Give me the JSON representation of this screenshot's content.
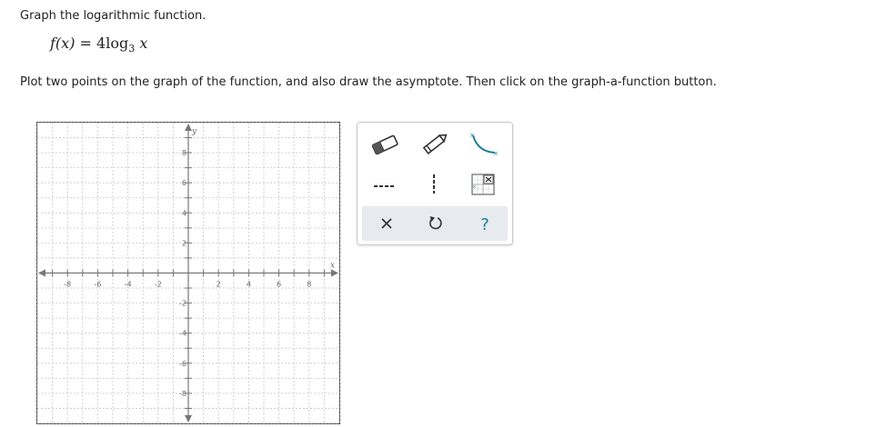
{
  "prompt": "Graph the logarithmic function.",
  "formula": {
    "lhs": "f(x)",
    "equals": "=",
    "coefficient": "4",
    "func": "log",
    "base": "3",
    "arg": "x"
  },
  "instructions": "Plot two points on the graph of the function, and also draw the asymptote. Then click on the graph-a-function button.",
  "graph": {
    "x_axis_label": "x",
    "y_axis_label": "y",
    "x_range": [
      -10,
      10
    ],
    "y_range": [
      -10,
      10
    ],
    "grid_step": 1,
    "x_tick_labels": [
      "-8",
      "-6",
      "-4",
      "-2",
      "2",
      "4",
      "6",
      "8"
    ],
    "y_tick_labels": [
      "8",
      "6",
      "4",
      "2",
      "-2",
      "-4",
      "-6",
      "-8"
    ],
    "grid": true
  },
  "tools": [
    {
      "name": "eraser-tool",
      "icon": "eraser-icon"
    },
    {
      "name": "pencil-tool",
      "icon": "pencil-icon"
    },
    {
      "name": "curve-tool",
      "icon": "curve-icon"
    },
    {
      "name": "horizontal-asymptote-tool",
      "icon": "dashed-horizontal-line-icon"
    },
    {
      "name": "vertical-asymptote-tool",
      "icon": "dashed-vertical-line-icon"
    },
    {
      "name": "graph-function-tool",
      "icon": "graph-function-icon"
    }
  ],
  "actions": {
    "clear": {
      "icon": "close-icon"
    },
    "undo": {
      "icon": "undo-icon"
    },
    "help": {
      "icon": "question-icon",
      "label": "?"
    }
  },
  "colors": {
    "accent": "#1a7f93",
    "grid": "#c8c8c8",
    "axis": "#777777",
    "action_bar": "#e7eaee"
  }
}
